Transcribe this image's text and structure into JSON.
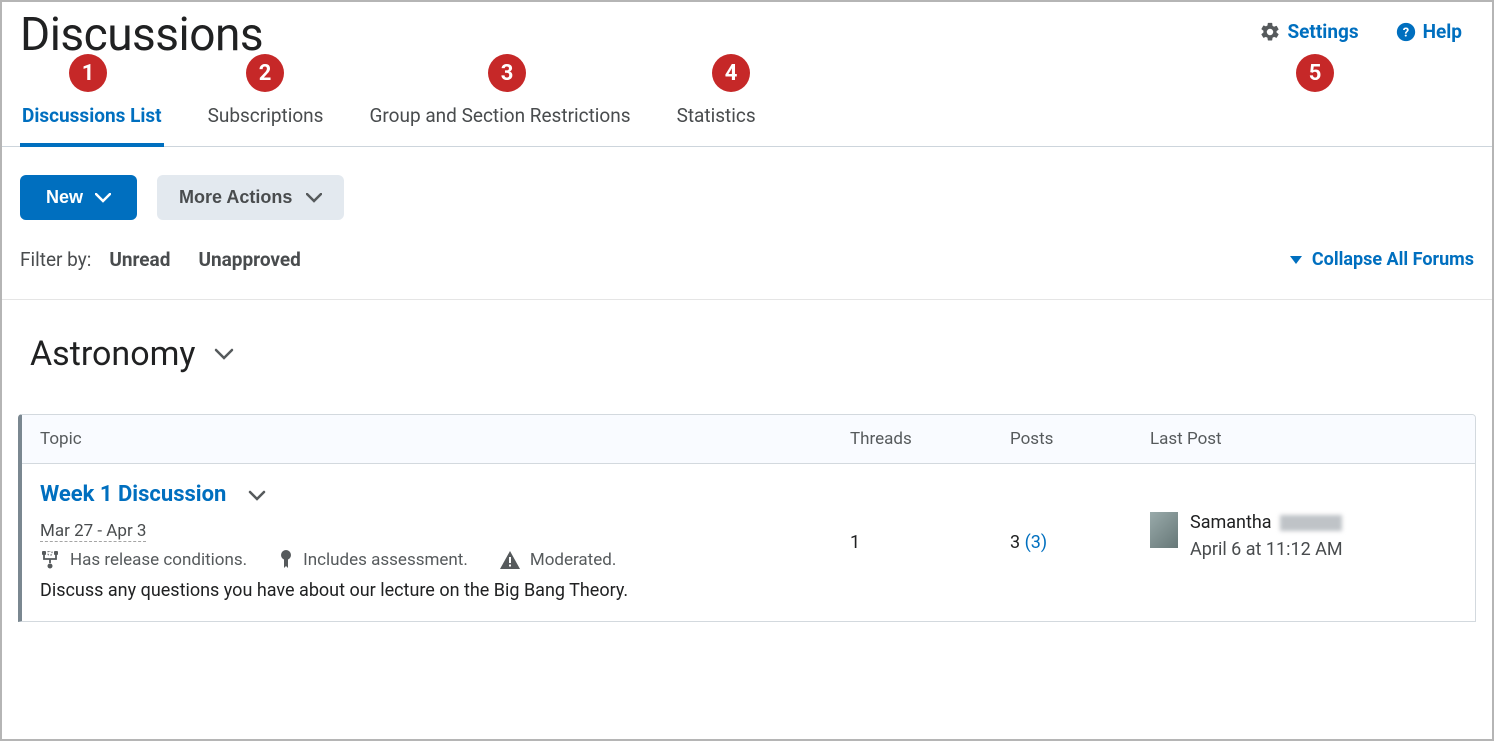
{
  "page": {
    "title": "Discussions"
  },
  "topRight": {
    "settings": "Settings",
    "help": "Help"
  },
  "tabs": [
    {
      "label": "Discussions List",
      "active": true
    },
    {
      "label": "Subscriptions",
      "active": false
    },
    {
      "label": "Group and Section Restrictions",
      "active": false
    },
    {
      "label": "Statistics",
      "active": false
    }
  ],
  "markers": [
    "1",
    "2",
    "3",
    "4",
    "5"
  ],
  "toolbar": {
    "new_label": "New",
    "more_actions_label": "More Actions"
  },
  "filters": {
    "label": "Filter by:",
    "unread": "Unread",
    "unapproved": "Unapproved",
    "collapse": "Collapse All Forums"
  },
  "forum": {
    "title": "Astronomy",
    "columns": {
      "topic": "Topic",
      "threads": "Threads",
      "posts": "Posts",
      "last_post": "Last Post"
    },
    "topic": {
      "title": "Week 1 Discussion",
      "date_range": "Mar 27 - Apr 3",
      "release_conditions": "Has release conditions.",
      "includes_assessment": "Includes assessment.",
      "moderated": "Moderated.",
      "description": "Discuss any questions you have about our lecture on the Big Bang Theory.",
      "threads": "1",
      "posts_total": "3",
      "posts_unread": "(3)",
      "last_post_name": "Samantha",
      "last_post_time": "April 6 at 11:12 AM"
    }
  }
}
